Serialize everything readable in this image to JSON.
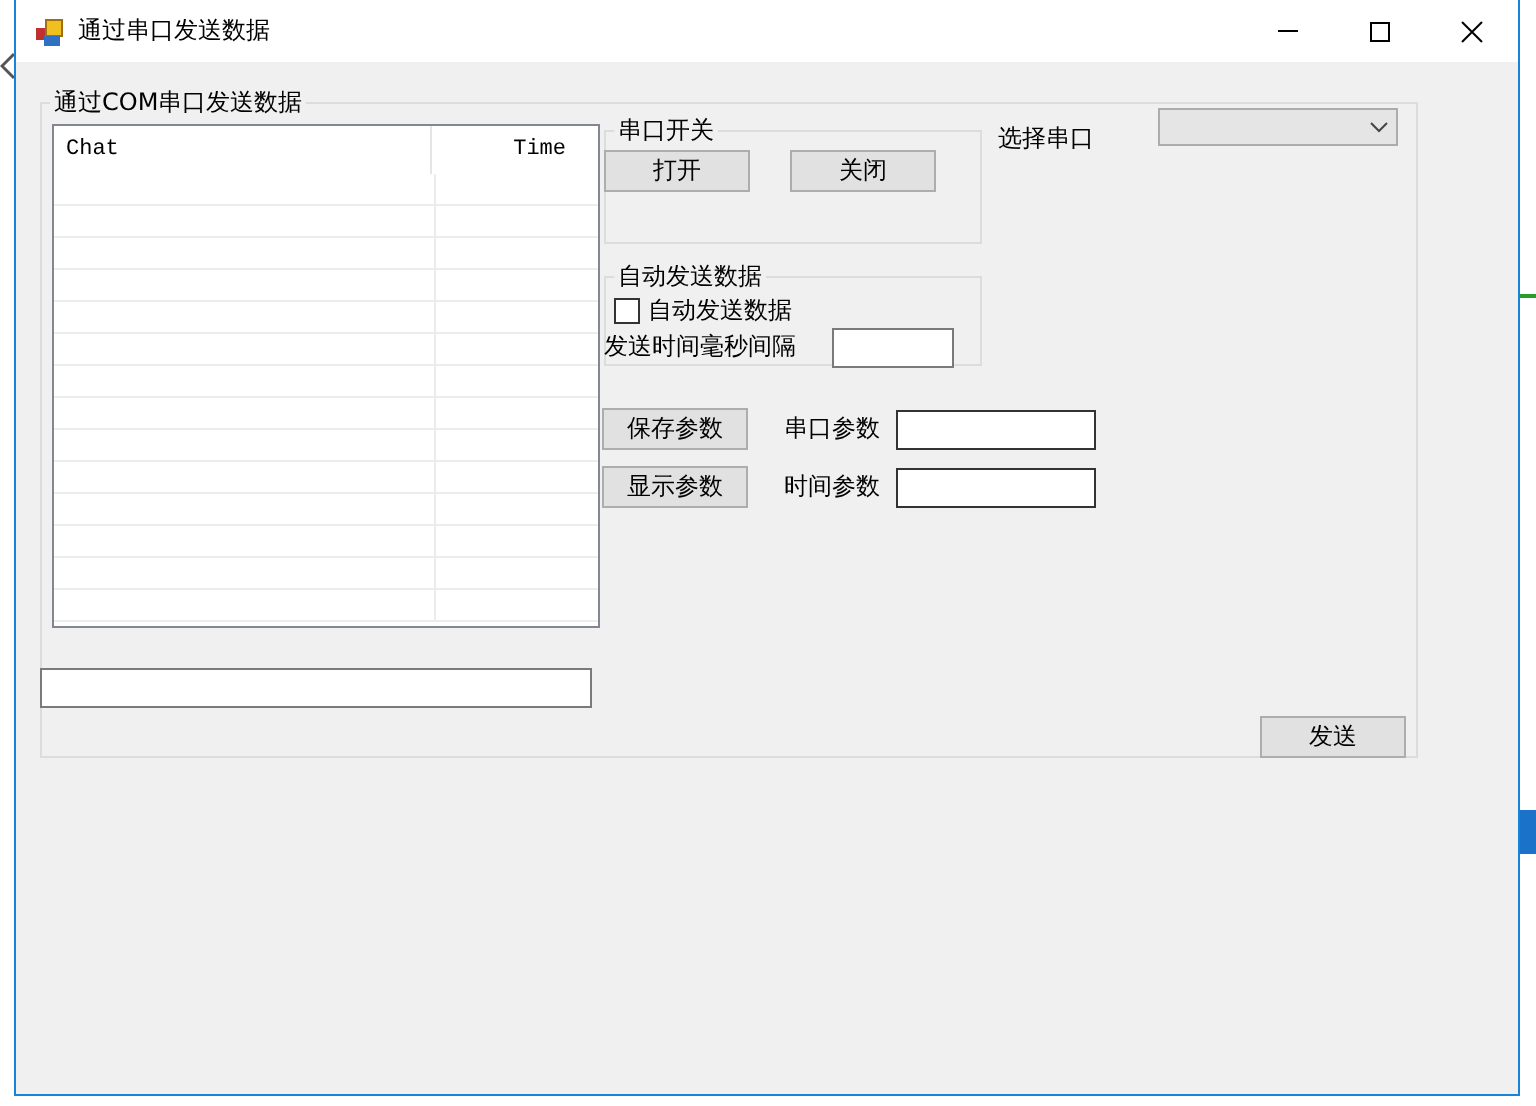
{
  "window": {
    "title": "通过串口发送数据"
  },
  "group": {
    "title": "通过COM串口发送数据"
  },
  "list": {
    "columns": [
      "Chat",
      "Time"
    ]
  },
  "send_button": "发送",
  "port_switch": {
    "title": "串口开关",
    "buttons": [
      "打开",
      "关闭"
    ]
  },
  "port_select": {
    "label": "选择串口"
  },
  "auto_send": {
    "title": "自动发送数据",
    "checkbox": {
      "label": "自动发送数据",
      "checked": false
    },
    "interval_label": "发送时间毫秒间隔"
  },
  "params": [
    {
      "button": "保存参数",
      "label": "串口参数"
    },
    {
      "button": "显示参数",
      "label": "时间参数"
    }
  ]
}
